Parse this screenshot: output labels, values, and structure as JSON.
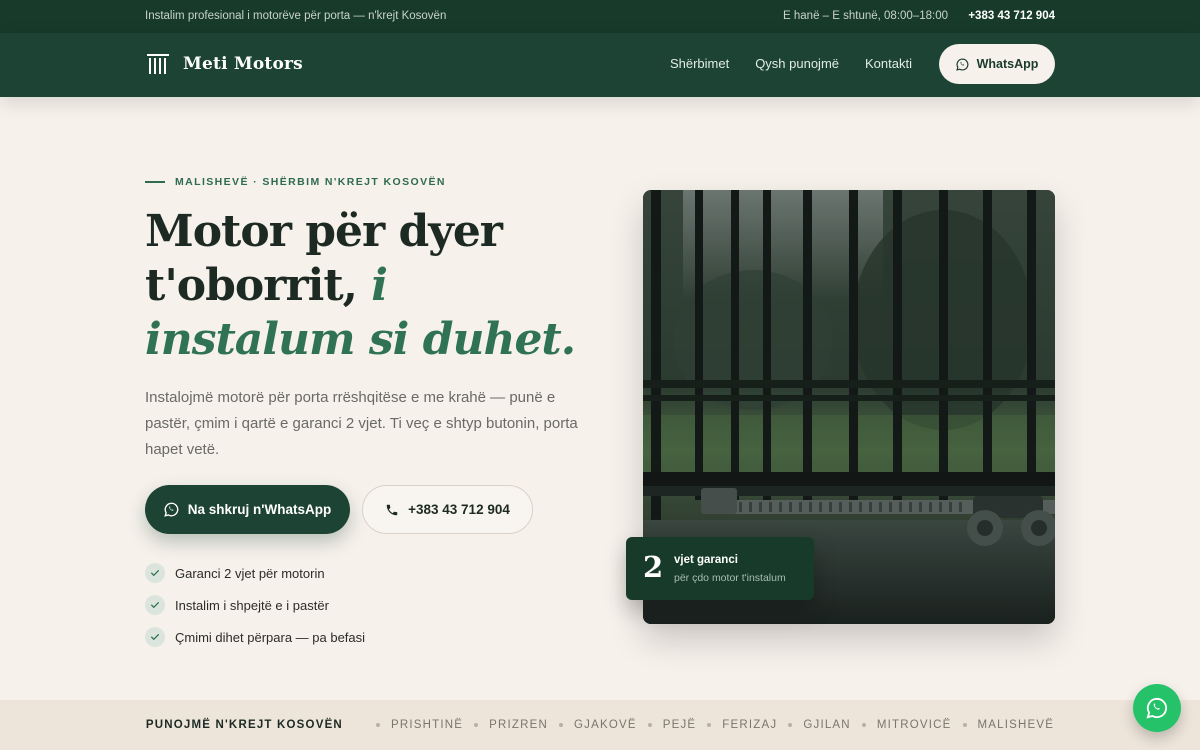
{
  "topbar": {
    "tagline": "Instalim profesional i motorëve për porta — n'krejt Kosovën",
    "hours": "E hanë – E shtunë, 08:00–18:00",
    "phone": "+383 43 712 904"
  },
  "nav": {
    "brand": "Meti Motors",
    "links": [
      "Shërbimet",
      "Qysh punojmë",
      "Kontakti"
    ],
    "cta": "WhatsApp"
  },
  "hero": {
    "eyebrow": "MALISHEVË · SHËRBIM N'KREJT KOSOVËN",
    "title_part1": "Motor për dyer t'oborrit, ",
    "title_accent": "i instalum si duhet.",
    "description": "Instalojmë motorë për porta rrëshqitëse e me krahë — punë e pastër, çmim i qartë e garanci 2 vjet. Ti veç e shtyp butonin, porta hapet vetë.",
    "primary_cta": "Na shkruj n'WhatsApp",
    "secondary_cta": "+383 43 712 904",
    "checks": [
      "Garanci 2 vjet për motorin",
      "Instalim i shpejtë e i pastër",
      "Çmimi dihet përpara — pa befasi"
    ]
  },
  "badge": {
    "number": "2",
    "title": "vjet garanci",
    "subtitle": "për çdo motor t'instalum"
  },
  "cities_strip": {
    "label": "PUNOJMË N'KREJT KOSOVËN",
    "cities": [
      "PRISHTINË",
      "PRIZREN",
      "GJAKOVË",
      "PEJË",
      "FERIZAJ",
      "GJILAN",
      "MITROVICË",
      "MALISHEVË"
    ]
  },
  "colors": {
    "primary": "#1c4333",
    "accent": "#2f7353",
    "background": "#f6f1eb",
    "whatsapp": "#25c26a"
  },
  "icons": {
    "logo": "gate-bars-icon",
    "whatsapp": "whatsapp-icon",
    "phone": "phone-icon",
    "check": "check-icon"
  }
}
